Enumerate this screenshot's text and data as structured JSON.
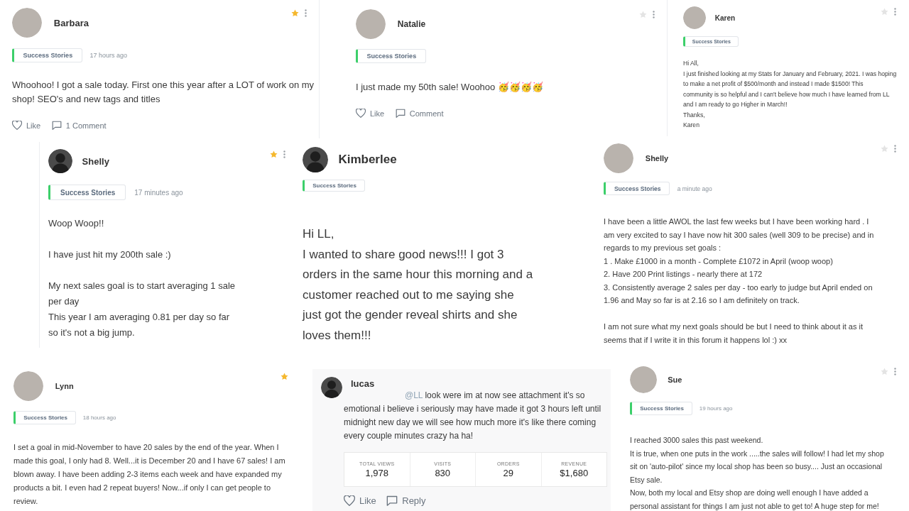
{
  "posts": [
    {
      "author": "Barbara",
      "avatar": {
        "kind": "photo"
      },
      "starred": true,
      "menu": true,
      "tag": "Success Stories",
      "time": "17 hours ago",
      "body": [
        [
          "Whoohoo! I got a sale today. First one this year after a LOT of work on my",
          "shop! SEO's and new tags and titles"
        ]
      ],
      "actions": [
        {
          "kind": "like",
          "label": "Like"
        },
        {
          "kind": "comment",
          "label": "1 Comment"
        }
      ]
    },
    {
      "author": "Natalie",
      "avatar": {
        "kind": "photo"
      },
      "starred": false,
      "menu": true,
      "tag": "Success Stories",
      "body": [
        [
          "I just made my 50th sale! Woohoo 🥳🥳🥳🥳"
        ]
      ],
      "actions": [
        {
          "kind": "like",
          "label": "Like"
        },
        {
          "kind": "comment",
          "label": "Comment"
        }
      ]
    },
    {
      "author": "Karen",
      "avatar": {
        "kind": "photo"
      },
      "starred": false,
      "menu": true,
      "tag": "Success Stories",
      "body": [
        [
          "Hi All,",
          "I just finished looking at my Stats for January and February, 2021.  I was hoping",
          "to make a net profit of $500/month and instead I made $1500!  This",
          "community is so helpful and I can't believe how much I have learned from LL",
          "and I am ready to go Higher in March!!",
          "Thanks,",
          "Karen"
        ]
      ]
    },
    {
      "author": "Shelly",
      "avatar": {
        "kind": "silhouette"
      },
      "starred": true,
      "menu": true,
      "tag": "Success Stories",
      "time": "17 minutes ago",
      "body": [
        [
          "Woop Woop!!"
        ],
        [
          "I have just hit my 200th sale :)"
        ],
        [
          "My next sales goal is to start averaging 1 sale",
          "per day",
          "This year I am averaging 0.81 per day so far",
          "so it's not a big jump."
        ]
      ]
    },
    {
      "author": "Kimberlee",
      "avatar": {
        "kind": "silhouette"
      },
      "tag": "Success Stories",
      "body": [
        [
          "Hi LL,",
          "I wanted to share good news!!! I got 3",
          "orders in the same hour this morning and a",
          "customer reached out to me saying she",
          "just got the gender reveal shirts and she",
          "loves them!!!"
        ]
      ]
    },
    {
      "author": "Shelly",
      "avatar": {
        "kind": "photo"
      },
      "starred": false,
      "menu": true,
      "tag": "Success Stories",
      "time": "a minute ago",
      "body": [
        [
          "I have been a little AWOL the last few weeks but I have been working hard . I",
          "am very excited to say I have now hit 300 sales (well 309 to be precise) and in",
          "regards to my previous set goals :",
          "1 . Make £1000 in a month - Complete £1072 in April (woop woop)",
          "2. Have 200 Print listings - nearly there at 172",
          "3. Consistently average 2 sales per day - too early to judge but April ended on",
          "1.96 and May so far is at 2.16 so I am definitely on track."
        ],
        [
          "I am not sure what my next goals should be but I need to think about it as it",
          "seems that if I write it in this forum it happens lol :) xx"
        ]
      ]
    },
    {
      "author": "Lynn",
      "avatar": {
        "kind": "photo"
      },
      "starred": true,
      "tag": "Success Stories",
      "time": "18 hours ago",
      "body": [
        [
          "I set a goal in mid-November to have 20 sales by the end of the year. When I",
          "made this goal, I only had 8. Well...it is December 20 and I have 67 sales! I am",
          "blown away. I have been adding 2-3 items each week and have expanded my",
          "products a bit. I even had 2 repeat buyers! Now...if only I can get people to",
          "review."
        ]
      ]
    },
    {
      "author": "lucas",
      "avatar": {
        "kind": "silhouette"
      },
      "mention": "@LL",
      "body": [
        [
          "look were im at now see attachment it's so",
          "emotional i believe i seriously may have made it got 3 hours left until",
          "midnight new day we will see how much more it's like there coming",
          "every couple minutes crazy ha ha!"
        ]
      ],
      "stats": [
        {
          "label": "TOTAL VIEWS",
          "value": "1,978"
        },
        {
          "label": "VISITS",
          "value": "830"
        },
        {
          "label": "ORDERS",
          "value": "29"
        },
        {
          "label": "REVENUE",
          "value": "$1,680"
        }
      ],
      "actions": [
        {
          "kind": "like",
          "label": "Like"
        },
        {
          "kind": "reply",
          "label": "Reply"
        }
      ]
    },
    {
      "author": "Sue",
      "avatar": {
        "kind": "photo"
      },
      "starred": false,
      "menu": true,
      "tag": "Success Stories",
      "time": "19 hours ago",
      "body": [
        [
          "I reached 3000 sales this past weekend.",
          "It is true, when one puts in the work .....the sales will follow!  I had let my shop",
          "sit on 'auto-pilot' since my local shop has been so busy....   Just an occasional",
          "Etsy sale.",
          "Now, both my local and Etsy shop are doing well enough I have added a",
          "personal assistant for things I am just not able to get to!  A huge step for me!"
        ]
      ]
    }
  ]
}
